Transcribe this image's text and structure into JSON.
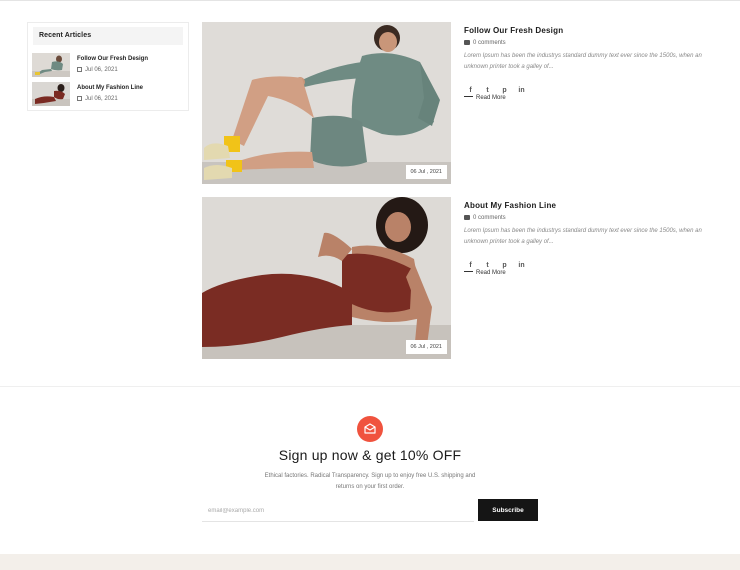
{
  "sidebar": {
    "heading": "Recent Articles",
    "items": [
      {
        "title": "Follow Our Fresh Design",
        "date": "Jul 06, 2021"
      },
      {
        "title": "About My Fashion Line",
        "date": "Jul 06, 2021"
      }
    ]
  },
  "posts": [
    {
      "title": "Follow Our Fresh Design",
      "comments": "0 comments",
      "excerpt": "Lorem Ipsum has been the industrys standard dummy text ever since the 1500s, when an unknown printer took a galley of...",
      "date_badge": "06 Jul , 2021",
      "read_more": "Read More",
      "social": [
        "f",
        "t",
        "p",
        "in"
      ]
    },
    {
      "title": "About My Fashion Line",
      "comments": "0 comments",
      "excerpt": "Lorem Ipsum has been the industrys standard dummy text ever since the 1500s, when an unknown printer took a galley of...",
      "date_badge": "06 Jul , 2021",
      "read_more": "Read More",
      "social": [
        "f",
        "t",
        "p",
        "in"
      ]
    }
  ],
  "newsletter": {
    "icon": "envelope-icon",
    "title": "Sign up now & get 10% OFF",
    "text": "Ethical factories. Radical Transparency. Sign up to enjoy free U.S. shipping and returns on your first order.",
    "placeholder": "email@example.com",
    "button_label": "Subscribe"
  },
  "colors": {
    "accent": "#f0533e",
    "button_bg": "#151515",
    "footer_band": "#f3efea"
  }
}
